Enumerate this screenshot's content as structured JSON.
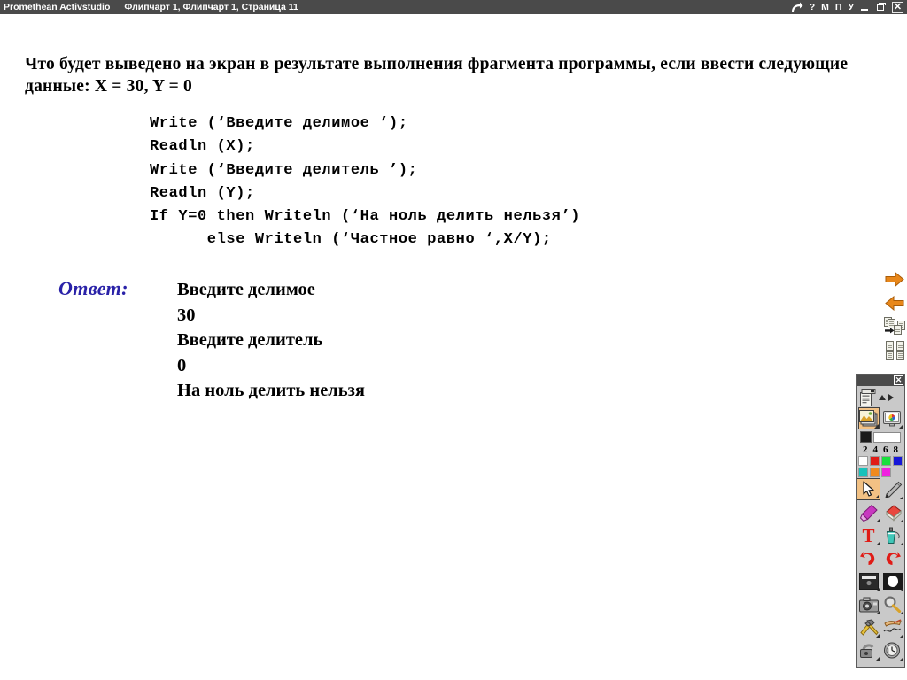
{
  "titlebar": {
    "app_name": "Promethean Activstudio",
    "document_path": "Флипчарт 1,  Флипчарт 1,  Страница 11",
    "redo_icon": "redo-arrow-icon",
    "help_label": "?",
    "letter_m": "М",
    "letter_p": "П",
    "letter_u": "У",
    "minimize_label": "minimize",
    "maximize_label": "maximize",
    "close_label": "✕"
  },
  "slide": {
    "question": "Что будет выведено на экран в результате выполнения фрагмента программы, если ввести следующие данные: X = 30, Y = 0",
    "code": "Write (‘Введите делимое ’);\nReadln (X);\nWrite (‘Введите делитель ’);\nReadln (Y);\nIf Y=0 then Writeln (‘На ноль делить нельзя’)\n      else Writeln (‘Частное равно ‘,X/Y);",
    "answer_label": "Ответ:",
    "answer_output": "Введите делимое\n30\nВведите делитель\n0\nНа ноль делить нельзя",
    "answer_label_color": "#2a22a8"
  },
  "edge_tools": {
    "items": [
      {
        "name": "next-page-button",
        "icon": "arrow-right-icon"
      },
      {
        "name": "previous-page-button",
        "icon": "arrow-left-icon"
      },
      {
        "name": "duplicate-page-button",
        "icon": "page-duplicate-icon"
      },
      {
        "name": "page-thumbnails-button",
        "icon": "page-grid-icon"
      }
    ]
  },
  "palette": {
    "close_label": "✕",
    "menu_icon": "flipchart-menu-icon",
    "scroll_up_icon": "triangle-up-icon",
    "scroll_right_icon": "triangle-right-icon",
    "mode_buttons": [
      {
        "name": "flipchart-mode-button",
        "icon": "flipchart-mode-icon",
        "selected": true
      },
      {
        "name": "desktop-mode-button",
        "icon": "desktop-mode-icon",
        "selected": false
      }
    ],
    "current_width_swatch": "#1a1a1a",
    "width_values": [
      "2",
      "4",
      "6",
      "8"
    ],
    "colors_row1": [
      "#ffffff",
      "#e01b16",
      "#19e03c",
      "#1616d8"
    ],
    "colors_row2": [
      "#17c2bb",
      "#f08a1e",
      "#f020e0",
      ""
    ],
    "tools": [
      {
        "name": "select-tool",
        "icon": "cursor-arrow-icon",
        "selected": true
      },
      {
        "name": "pen-tool",
        "icon": "pen-icon",
        "selected": false
      },
      {
        "name": "highlighter-tool",
        "icon": "highlighter-icon",
        "selected": false
      },
      {
        "name": "eraser-tool",
        "icon": "eraser-icon",
        "selected": false
      },
      {
        "name": "text-tool",
        "icon": "text-t-icon",
        "selected": false
      },
      {
        "name": "fill-tool",
        "icon": "fill-bucket-icon",
        "selected": false
      },
      {
        "name": "undo-button",
        "icon": "undo-arrow-icon",
        "selected": false
      },
      {
        "name": "redo-button",
        "icon": "redo-arrow-icon",
        "selected": false
      },
      {
        "name": "shade-tool",
        "icon": "revealer-blind-icon",
        "selected": false
      },
      {
        "name": "spotlight-tool",
        "icon": "spotlight-icon",
        "selected": false
      },
      {
        "name": "camera-tool",
        "icon": "camera-icon",
        "selected": false
      },
      {
        "name": "magnifier-tool",
        "icon": "magnifier-icon",
        "selected": false
      },
      {
        "name": "tools-menu",
        "icon": "hammer-wrench-icon",
        "selected": false
      },
      {
        "name": "handwriting-tool",
        "icon": "hand-writing-icon",
        "selected": false
      },
      {
        "name": "lock-tool",
        "icon": "padlock-icon",
        "selected": false
      },
      {
        "name": "clock-tool",
        "icon": "clock-icon",
        "selected": false
      }
    ]
  }
}
